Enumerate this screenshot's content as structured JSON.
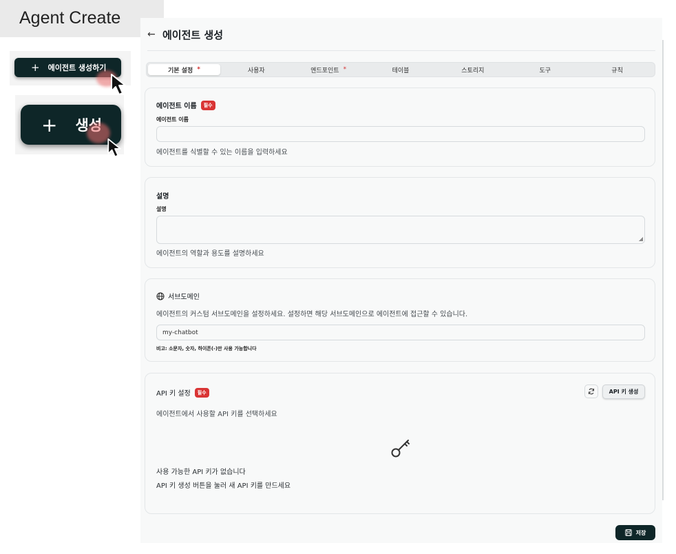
{
  "caption": "Agent Create",
  "zoom_small": {
    "plus": "+",
    "label": "에이전트 생성하기"
  },
  "zoom_large": {
    "plus": "+",
    "label": "생성"
  },
  "header": {
    "back": "←",
    "title": "에이전트 생성"
  },
  "tabs": [
    {
      "label": "기본 설정",
      "required": "*",
      "active": true
    },
    {
      "label": "사용자",
      "required": "",
      "active": false
    },
    {
      "label": "엔드포인트",
      "required": "*",
      "active": false
    },
    {
      "label": "테이블",
      "required": "",
      "active": false
    },
    {
      "label": "스토리지",
      "required": "",
      "active": false
    },
    {
      "label": "도구",
      "required": "",
      "active": false
    },
    {
      "label": "규칙",
      "required": "",
      "active": false
    }
  ],
  "name_card": {
    "title": "에이전트 이름",
    "badge": "필수",
    "field_label": "에이전트 이름",
    "value": "",
    "help": "에이전트를 식별할 수 있는 이름을 입력하세요"
  },
  "desc_card": {
    "title": "설명",
    "field_label": "설명",
    "value": "",
    "help": "에이전트의 역할과 용도를 설명하세요"
  },
  "subdomain_card": {
    "icon": "globe-icon",
    "title": "서브도메인",
    "help": "에이전트의 커스텀 서브도메인을 설정하세요. 설정하면 해당 서브도메인으로 에이전트에 접근할 수 있습니다.",
    "placeholder": "my-chatbot",
    "note": "비고: 소문자, 숫자, 하이픈(-)만 사용 가능합니다"
  },
  "api_card": {
    "title": "API 키 설정",
    "badge": "필수",
    "help": "에이전트에서 사용할 API 키를 선택하세요",
    "refresh_icon": "refresh-icon",
    "generate_label": "API 키 생성",
    "empty_icon": "key-icon",
    "empty_title": "사용 가능한 API 키가 없습니다",
    "empty_hint": "API 키 생성 버튼을 눌러 새 API 키를 만드세요"
  },
  "save_label": "저장",
  "colors": {
    "primary": "#0e2628",
    "required": "#d93434",
    "panel": "#f8f9f9"
  }
}
